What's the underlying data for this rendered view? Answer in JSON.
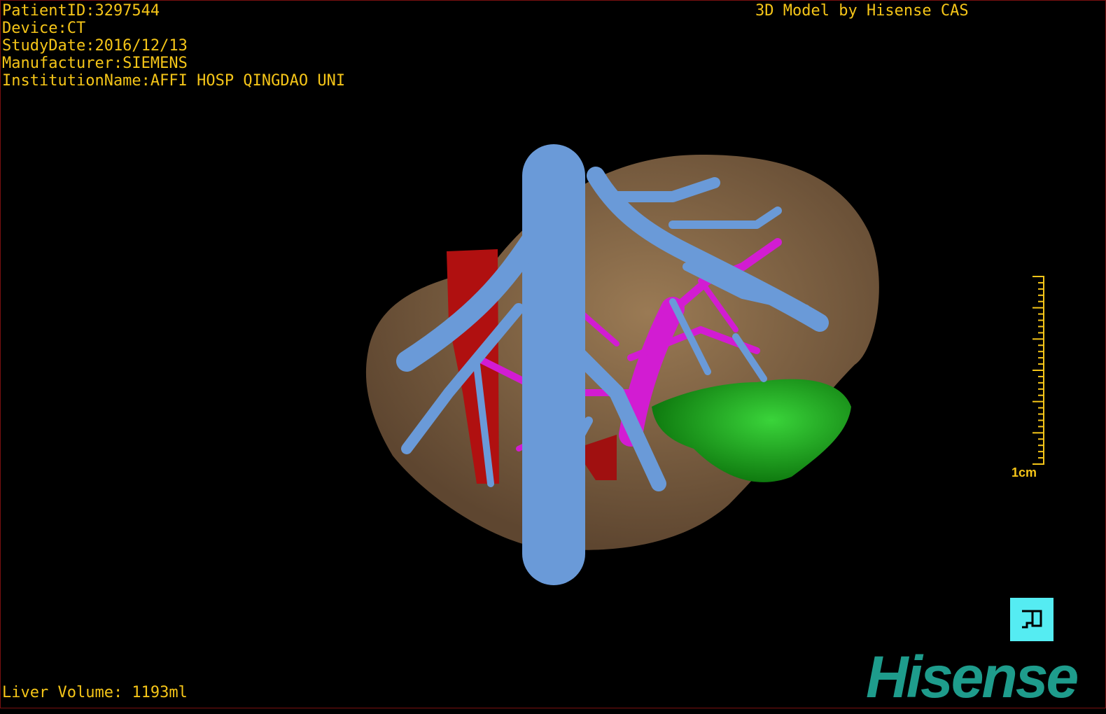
{
  "overlay": {
    "patient_id": "PatientID:3297544",
    "device": "Device:CT",
    "study_date": "StudyDate:2016/12/13",
    "manufacturer": "Manufacturer:SIEMENS",
    "institution": "InstitutionName:AFFI HOSP QINGDAO UNI",
    "model_credit": "3D Model by Hisense CAS",
    "liver_volume": "Liver Volume: 1193ml"
  },
  "scale_bar": {
    "label": "1cm"
  },
  "orientation_button": {
    "icon": "orientation-cube-icon"
  },
  "logo": {
    "text": "Hisense"
  },
  "colors": {
    "overlay_text": "#f5c518",
    "liver": "#8a6c4a",
    "hepatic_vein": "#6a9ad8",
    "portal_vein": "#d21cd2",
    "artery": "#b01010",
    "lesion": "#1fa01f",
    "logo": "#1e9c8c",
    "button": "#55ecf2"
  }
}
